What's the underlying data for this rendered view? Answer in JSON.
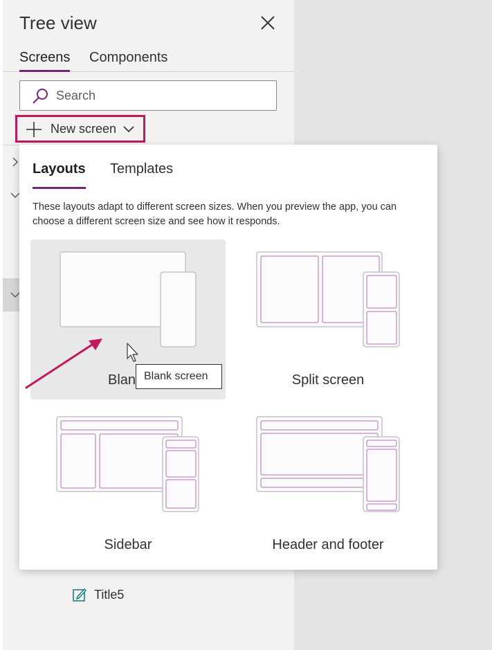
{
  "panel": {
    "title": "Tree view",
    "tabs": [
      {
        "label": "Screens",
        "active": true
      },
      {
        "label": "Components",
        "active": false
      }
    ],
    "search": {
      "placeholder": "Search",
      "value": ""
    },
    "new_screen_label": "New screen",
    "tree_item_label": "Title5"
  },
  "popup": {
    "tabs": [
      {
        "label": "Layouts",
        "active": true
      },
      {
        "label": "Templates",
        "active": false
      }
    ],
    "description": "These layouts adapt to different screen sizes. When you preview the app, you can choose a different screen size and see how it responds.",
    "layouts": [
      {
        "label": "Blank screen",
        "visible_label": "Blan"
      },
      {
        "label": "Split screen"
      },
      {
        "label": "Sidebar"
      },
      {
        "label": "Header and footer"
      }
    ],
    "tooltip": "Blank screen"
  },
  "colors": {
    "accent": "#742774",
    "highlight_box": "#c2185b",
    "panel_bg": "#f3f2f1",
    "canvas_bg": "#e4e4e4",
    "thumb_outline": "#b36db3"
  },
  "icons": [
    "close-icon",
    "search-icon",
    "plus-icon",
    "chevron-down-icon",
    "chevron-right-icon",
    "edit-icon",
    "mouse-pointer-icon",
    "annotation-arrow"
  ]
}
